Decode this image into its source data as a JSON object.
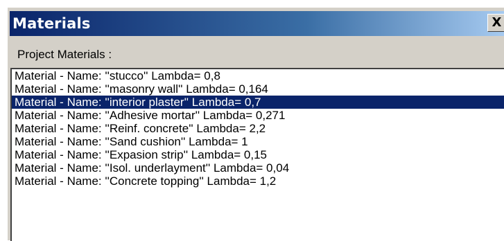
{
  "window": {
    "title": "Materials",
    "close_label": "X"
  },
  "section_label": "Project Materials :",
  "colors": {
    "titlebar_start": "#0a246a",
    "titlebar_end": "#a6caf0",
    "selection": "#0a246a",
    "dialog_bg": "#d4d0c8"
  },
  "materials": {
    "selected_index": 2,
    "items": [
      {
        "label": "Material - Name: ''stucco'' Lambda= 0,8"
      },
      {
        "label": "Material - Name: ''masonry wall'' Lambda= 0,164"
      },
      {
        "label": "Material - Name: ''interior plaster'' Lambda= 0,7"
      },
      {
        "label": "Material - Name: ''Adhesive mortar'' Lambda= 0,271"
      },
      {
        "label": "Material - Name: ''Reinf. concrete'' Lambda= 2,2"
      },
      {
        "label": "Material - Name: ''Sand cushion'' Lambda= 1"
      },
      {
        "label": "Material - Name: ''Expasion strip'' Lambda= 0,15"
      },
      {
        "label": "Material - Name: ''Isol. underlayment'' Lambda= 0,04"
      },
      {
        "label": "Material - Name: ''Concrete topping'' Lambda= 1,2"
      }
    ]
  }
}
